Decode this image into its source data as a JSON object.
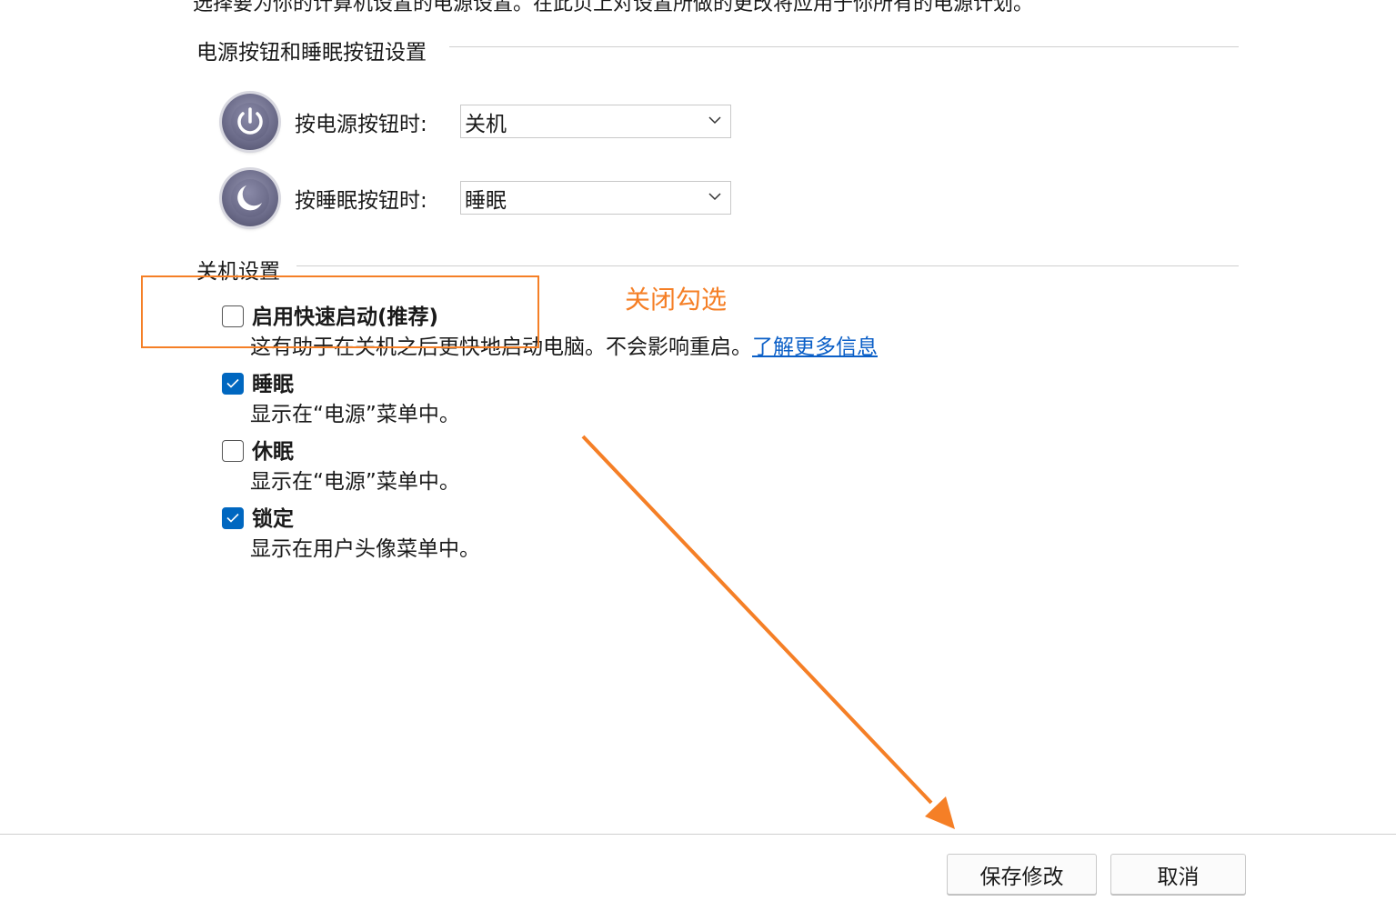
{
  "top_text": "选择要为你的计算机设置的电源设置。在此页上对设置所做的更改将应用于你所有的电源计划。",
  "power_buttons": {
    "section_title": "电源按钮和睡眠按钮设置",
    "power_label": "按电源按钮时:",
    "power_value": "关机",
    "sleep_label": "按睡眠按钮时:",
    "sleep_value": "睡眠"
  },
  "shutdown": {
    "section_title": "关机设置",
    "items": [
      {
        "label": "启用快速启动(推荐)",
        "desc": "这有助于在关机之后更快地启动电脑。不会影响重启。",
        "link": "了解更多信息",
        "checked": false
      },
      {
        "label": "睡眠",
        "desc": "显示在“电源”菜单中。",
        "checked": true
      },
      {
        "label": "休眠",
        "desc": "显示在“电源”菜单中。",
        "checked": false
      },
      {
        "label": "锁定",
        "desc": "显示在用户头像菜单中。",
        "checked": true
      }
    ]
  },
  "annotation": {
    "text": "关闭勾选",
    "color": "#f57f26"
  },
  "buttons": {
    "save": "保存修改",
    "cancel": "取消"
  },
  "colors": {
    "checkbox_checked": "#0067c0",
    "link": "#0b5fc7",
    "annotation": "#f57f26"
  }
}
